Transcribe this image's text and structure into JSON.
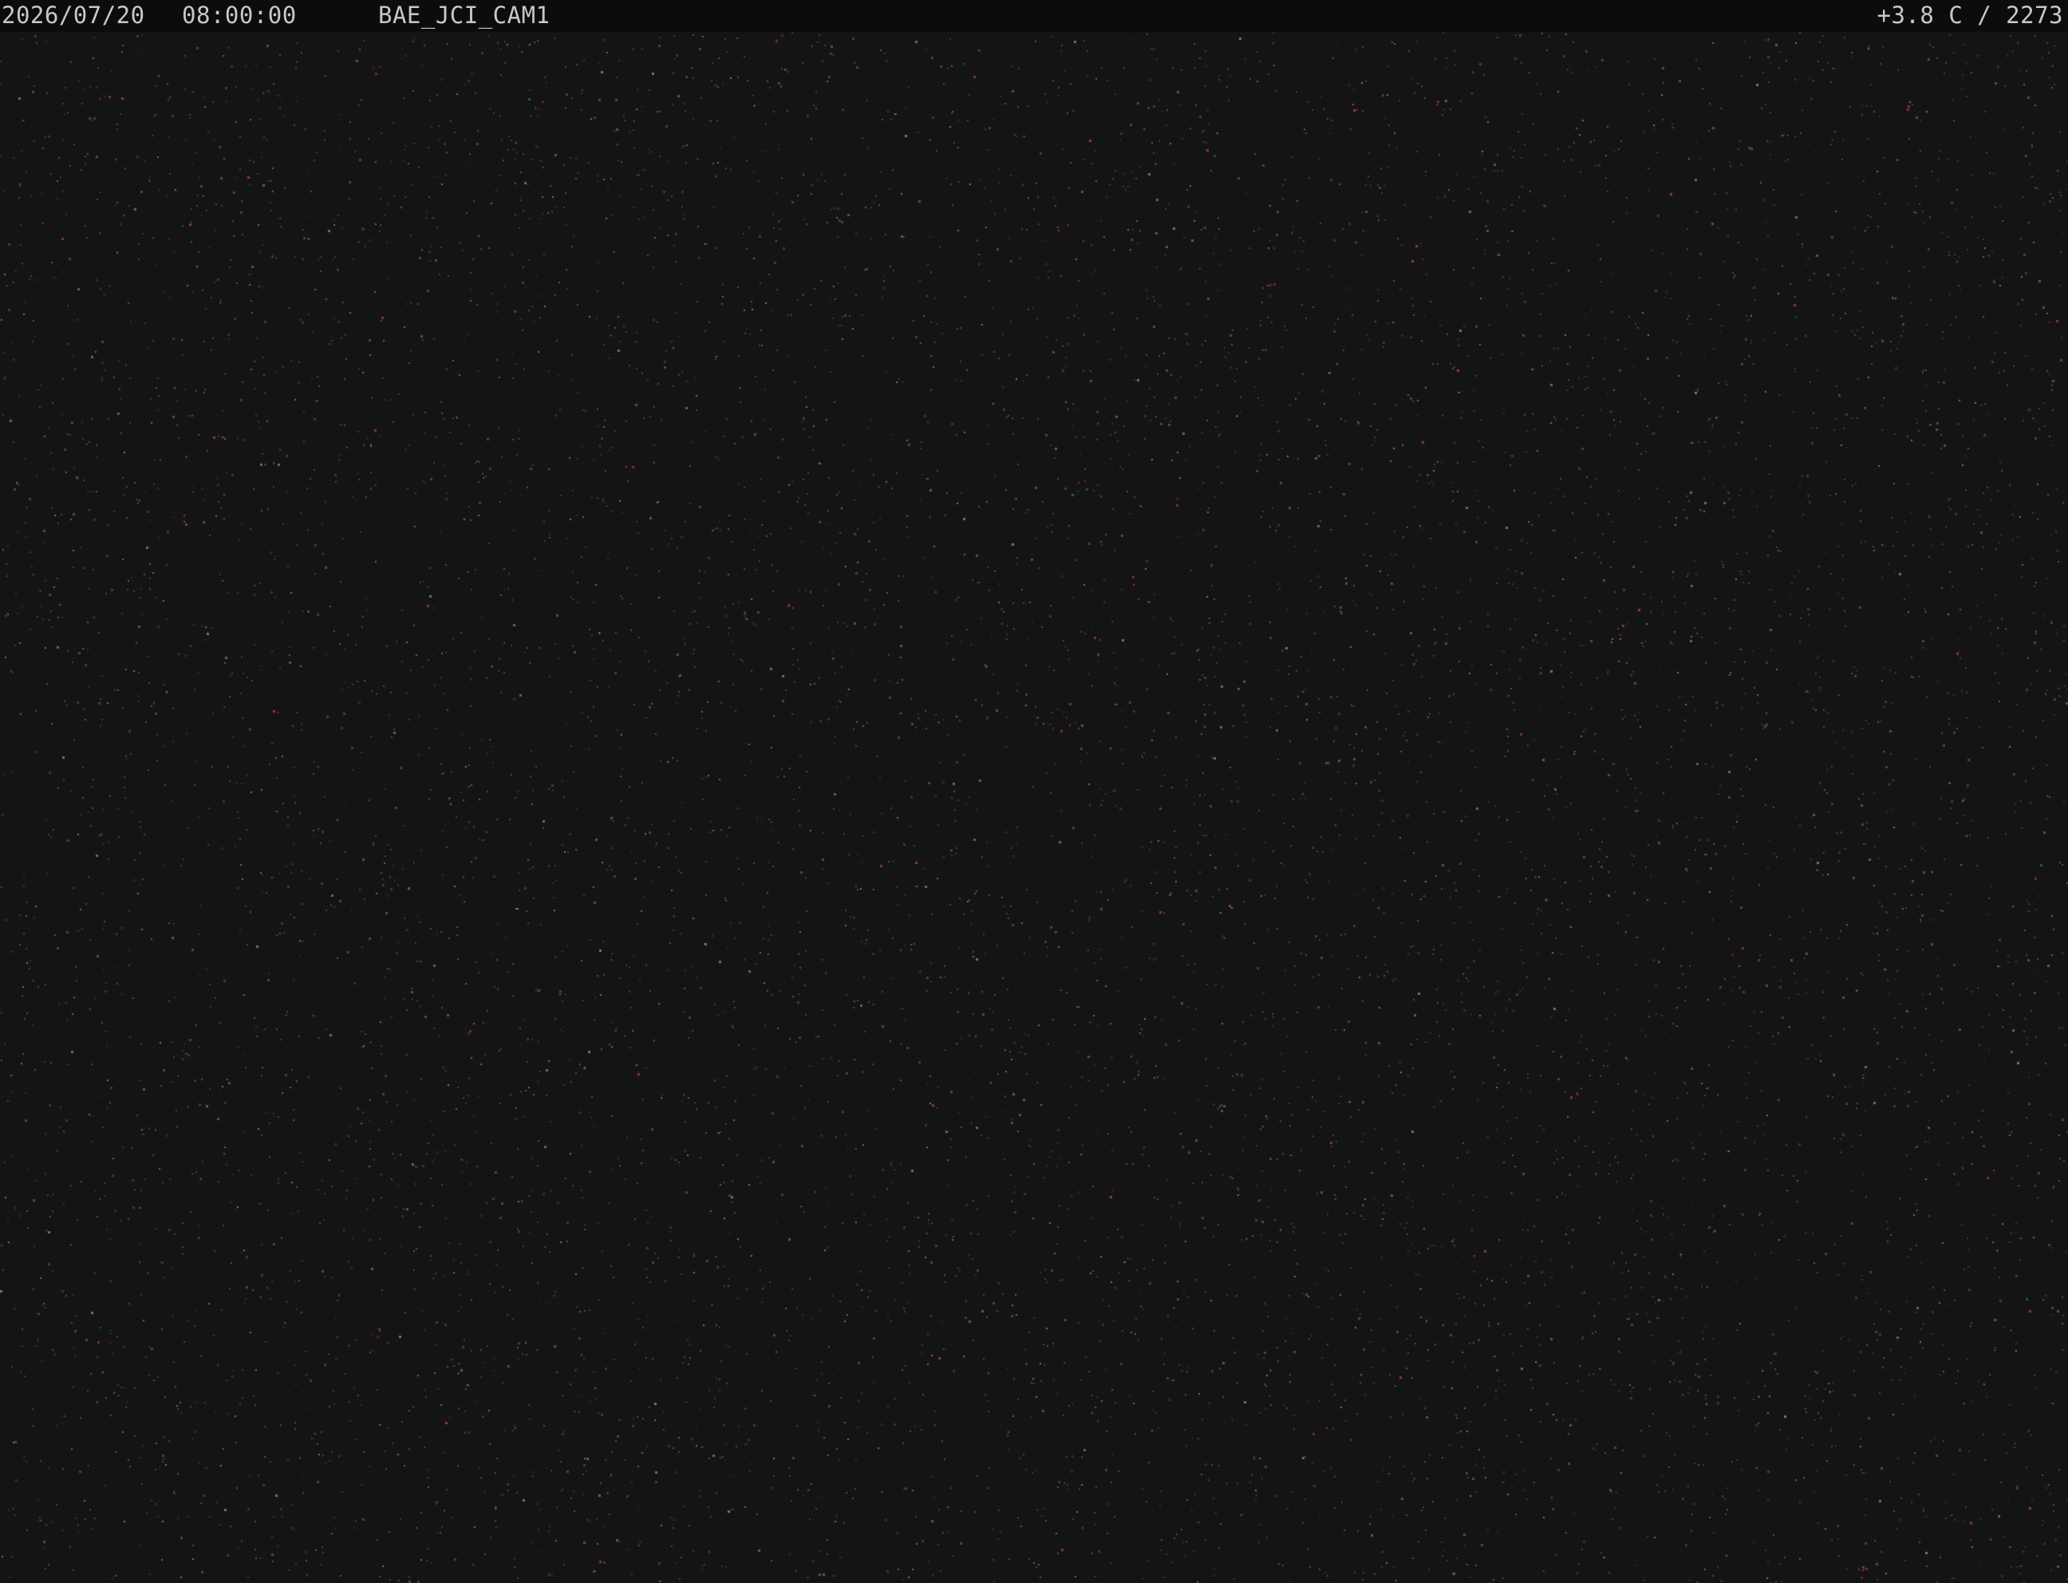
{
  "overlay": {
    "date": "2026/07/20",
    "time": "08:00:00",
    "camera_name": "BAE_JCI_CAM1",
    "temperature_altitude": "+3.8 C / 2273"
  },
  "image": {
    "description_type": "night-sky-camera-frame",
    "background_color": "#141414",
    "noise_colors": [
      "#b04050",
      "#3c6a46",
      "#3a3c9a",
      "#8a8a8a"
    ]
  }
}
